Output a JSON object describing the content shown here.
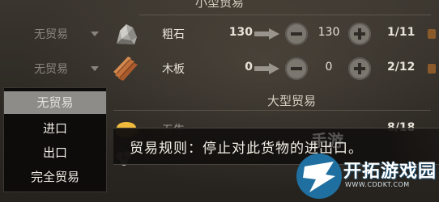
{
  "headers": {
    "small": "小型贸易",
    "large": "大型贸易"
  },
  "rows": [
    {
      "mode": "无贸易",
      "icon": "stone-icon",
      "name": "粗石",
      "left_amount": "130",
      "mid_amount": "130",
      "ratio": "1/11"
    },
    {
      "mode": "无贸易",
      "icon": "wood-plank-icon",
      "name": "木板",
      "left_amount": "0",
      "mid_amount": "0",
      "ratio": "2/12"
    },
    {
      "mode": "",
      "icon": "gold-icon",
      "name": "五生",
      "left_amount": "",
      "mid_amount": "",
      "ratio": "8/18"
    }
  ],
  "dropdown": {
    "options": [
      "无贸易",
      "进口",
      "出口",
      "完全贸易"
    ],
    "selected": "无贸易"
  },
  "tooltip": {
    "text": "贸易规则：停止对此货物的进出口。"
  },
  "watermark": {
    "title": "开拓游戏园",
    "url": "WWW.CDDKT.COM",
    "ghost_text": "手游"
  },
  "colors": {
    "background": "#2f2b26",
    "dropdown_bg": "#0d0c0b",
    "dropdown_selected": "#8e8c88",
    "button_grey": "#7b766e",
    "text_light": "#e8e3d8",
    "text_muted": "#8a857c",
    "watermark_blue": "#1f6fa0"
  }
}
